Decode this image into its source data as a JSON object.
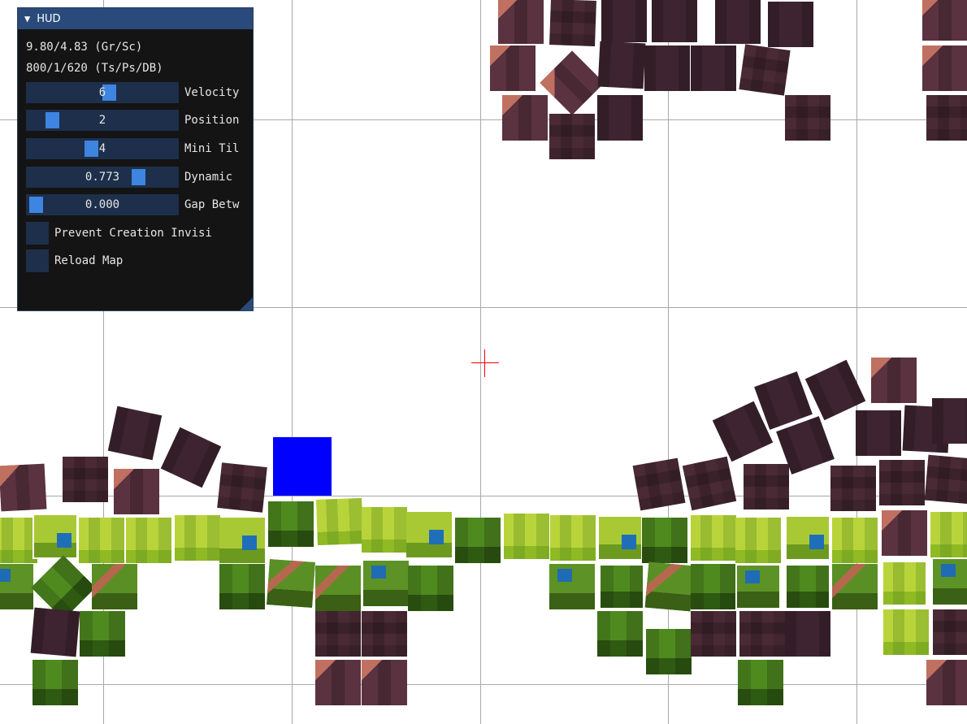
{
  "hud": {
    "title": "HUD",
    "collapse_icon": "triangle-down-icon",
    "stats": [
      "9.80/4.83 (Gr/Sc)",
      "800/1/620 (Ts/Ps/DB)"
    ],
    "sliders": [
      {
        "value": "6",
        "label": "Velocity",
        "fraction": 0.55
      },
      {
        "value": "2",
        "label": "Position",
        "fraction": 0.12
      },
      {
        "value": "4",
        "label": "Mini Til",
        "fraction": 0.42
      },
      {
        "value": "0.773",
        "label": "Dynamic",
        "fraction": 0.77
      },
      {
        "value": "0.000",
        "label": "Gap Betw",
        "fraction": 0.0
      }
    ],
    "checkboxes": [
      {
        "label": "Prevent Creation Invisi",
        "checked": false
      },
      {
        "label": "Reload Map",
        "checked": false
      }
    ]
  },
  "colors": {
    "player": "#0000ff",
    "crosshair": "#ff0000",
    "hud_title_bar": "#294a7a",
    "slider_grab": "#3d85e0",
    "grid": "#a9a9a9"
  }
}
